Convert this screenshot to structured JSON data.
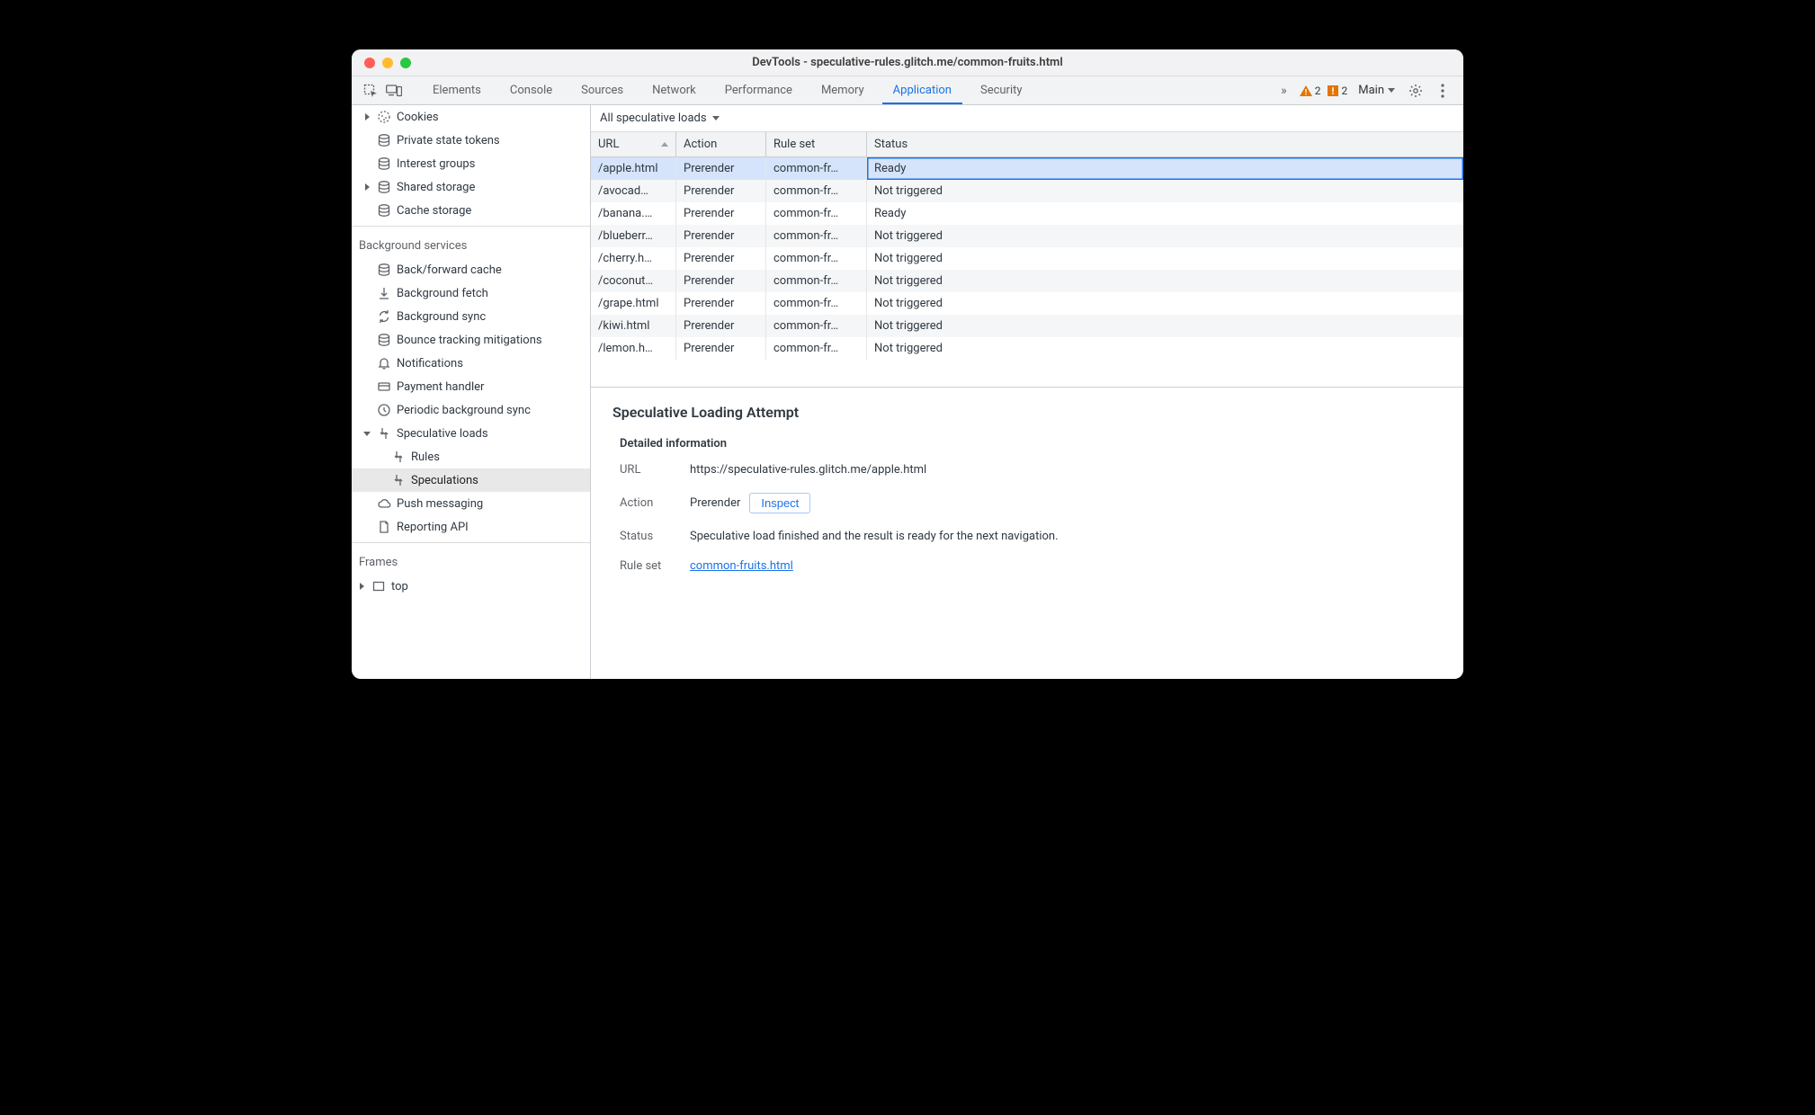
{
  "window": {
    "title": "DevTools - speculative-rules.glitch.me/common-fruits.html"
  },
  "toolbar": {
    "panels": [
      "Elements",
      "Console",
      "Sources",
      "Network",
      "Performance",
      "Memory",
      "Application",
      "Security"
    ],
    "active_panel": "Application",
    "warning_count": "2",
    "issue_count": "2",
    "context_label": "Main"
  },
  "sidebar": {
    "group_top": [
      {
        "icon": "cookies",
        "label": "Cookies",
        "expandable": true
      },
      {
        "icon": "db",
        "label": "Private state tokens"
      },
      {
        "icon": "db",
        "label": "Interest groups"
      },
      {
        "icon": "db",
        "label": "Shared storage",
        "expandable": true
      },
      {
        "icon": "db",
        "label": "Cache storage"
      }
    ],
    "bg_title": "Background services",
    "bg_items": [
      {
        "icon": "db",
        "label": "Back/forward cache"
      },
      {
        "icon": "fetch",
        "label": "Background fetch"
      },
      {
        "icon": "sync",
        "label": "Background sync"
      },
      {
        "icon": "db",
        "label": "Bounce tracking mitigations"
      },
      {
        "icon": "bell",
        "label": "Notifications"
      },
      {
        "icon": "card",
        "label": "Payment handler"
      },
      {
        "icon": "clock",
        "label": "Periodic background sync"
      },
      {
        "icon": "spec",
        "label": "Speculative loads",
        "expandable": true,
        "open": true
      },
      {
        "icon": "spec",
        "label": "Rules",
        "child": true
      },
      {
        "icon": "spec",
        "label": "Speculations",
        "child": true,
        "selected": true
      },
      {
        "icon": "cloud",
        "label": "Push messaging"
      },
      {
        "icon": "doc",
        "label": "Reporting API"
      }
    ],
    "frames_title": "Frames",
    "frames_items": [
      {
        "icon": "frame",
        "label": "top",
        "expandable": true
      }
    ]
  },
  "filter": {
    "label": "All speculative loads"
  },
  "grid": {
    "columns": [
      "URL",
      "Action",
      "Rule set",
      "Status"
    ],
    "rows": [
      {
        "url": "/apple.html",
        "action": "Prerender",
        "ruleset": "common-fr…",
        "status": "Ready",
        "selected": true
      },
      {
        "url": "/avocad…",
        "action": "Prerender",
        "ruleset": "common-fr…",
        "status": "Not triggered"
      },
      {
        "url": "/banana.…",
        "action": "Prerender",
        "ruleset": "common-fr…",
        "status": "Ready"
      },
      {
        "url": "/blueberr…",
        "action": "Prerender",
        "ruleset": "common-fr…",
        "status": "Not triggered"
      },
      {
        "url": "/cherry.h…",
        "action": "Prerender",
        "ruleset": "common-fr…",
        "status": "Not triggered"
      },
      {
        "url": "/coconut…",
        "action": "Prerender",
        "ruleset": "common-fr…",
        "status": "Not triggered"
      },
      {
        "url": "/grape.html",
        "action": "Prerender",
        "ruleset": "common-fr…",
        "status": "Not triggered"
      },
      {
        "url": "/kiwi.html",
        "action": "Prerender",
        "ruleset": "common-fr…",
        "status": "Not triggered"
      },
      {
        "url": "/lemon.h…",
        "action": "Prerender",
        "ruleset": "common-fr…",
        "status": "Not triggered"
      }
    ]
  },
  "detail": {
    "title": "Speculative Loading Attempt",
    "section_title": "Detailed information",
    "url_label": "URL",
    "url_value": "https://speculative-rules.glitch.me/apple.html",
    "action_label": "Action",
    "action_value": "Prerender",
    "inspect_label": "Inspect",
    "status_label": "Status",
    "status_value": "Speculative load finished and the result is ready for the next navigation.",
    "ruleset_label": "Rule set",
    "ruleset_link": "common-fruits.html"
  }
}
